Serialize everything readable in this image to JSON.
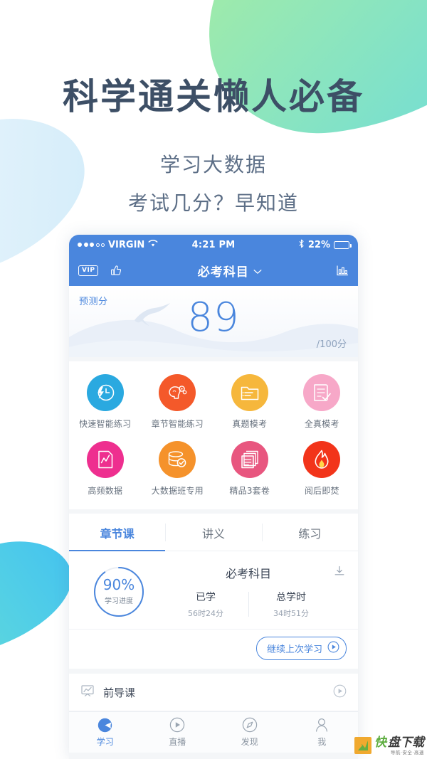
{
  "hero": {
    "title": "科学通关懒人必备",
    "subtitle_1": "学习大数据",
    "subtitle_2": "考试几分？早知道"
  },
  "phone": {
    "status_bar": {
      "carrier": "VIRGIN",
      "signal_dots_filled": 3,
      "signal_dots_total": 5,
      "wifi_icon": "wifi-icon",
      "time": "4:21 PM",
      "bluetooth_icon": "bluetooth-icon",
      "battery_percent": "22%",
      "battery_level": 22
    },
    "header": {
      "vip_label": "VIP",
      "thumb_icon": "thumbs-up-icon",
      "title": "必考科目",
      "chevron_icon": "chevron-down-icon",
      "chart_icon": "bar-chart-icon"
    },
    "score_panel": {
      "label": "预测分",
      "value": "89",
      "total": "/100分",
      "accent_color": "#4a86dd"
    },
    "grid": {
      "rows": [
        [
          {
            "label": "快速智能练习",
            "icon": "clock-lightning-icon",
            "color": "#2aa9e0"
          },
          {
            "label": "章节智能练习",
            "icon": "brain-gear-icon",
            "color": "#f4592a"
          },
          {
            "label": "真题模考",
            "icon": "folder-list-icon",
            "color": "#f6b73c"
          },
          {
            "label": "全真模考",
            "icon": "checklist-icon",
            "color": "#f7a8c8"
          }
        ],
        [
          {
            "label": "高频数据",
            "icon": "chart-document-icon",
            "color": "#ee2f8f"
          },
          {
            "label": "大数据班专用",
            "icon": "database-check-icon",
            "color": "#f5922b"
          },
          {
            "label": "精品3套卷",
            "icon": "papers-icon",
            "color": "#e8567f"
          },
          {
            "label": "阅后即焚",
            "icon": "flame-icon",
            "color": "#f2341a"
          }
        ]
      ]
    },
    "tabs": [
      {
        "label": "章节课",
        "active": true
      },
      {
        "label": "讲义",
        "active": false
      },
      {
        "label": "练习",
        "active": false
      }
    ],
    "progress": {
      "percent_text": "90%",
      "percent_value": 90,
      "caption": "学习进度",
      "course_title": "必考科目",
      "download_icon": "download-icon",
      "stats": [
        {
          "label": "已学",
          "value": "56时24分"
        },
        {
          "label": "总学时",
          "value": "34时51分"
        }
      ]
    },
    "continue_button": {
      "label": "继续上次学习",
      "icon": "play-circle-icon"
    },
    "list_items": [
      {
        "title": "前导课",
        "lead_icon": "chart-board-icon",
        "trail_icon": "play-circle-icon"
      }
    ],
    "bottom_nav": [
      {
        "label": "学习",
        "icon": "study-icon",
        "active": true
      },
      {
        "label": "直播",
        "icon": "play-circle-icon",
        "active": false
      },
      {
        "label": "发现",
        "icon": "compass-icon",
        "active": false
      },
      {
        "label": "我",
        "icon": "person-icon",
        "active": false
      }
    ]
  },
  "watermark": {
    "brand_a": "快",
    "brand_b": "盘下载",
    "tagline": "导航·安全·高速"
  }
}
